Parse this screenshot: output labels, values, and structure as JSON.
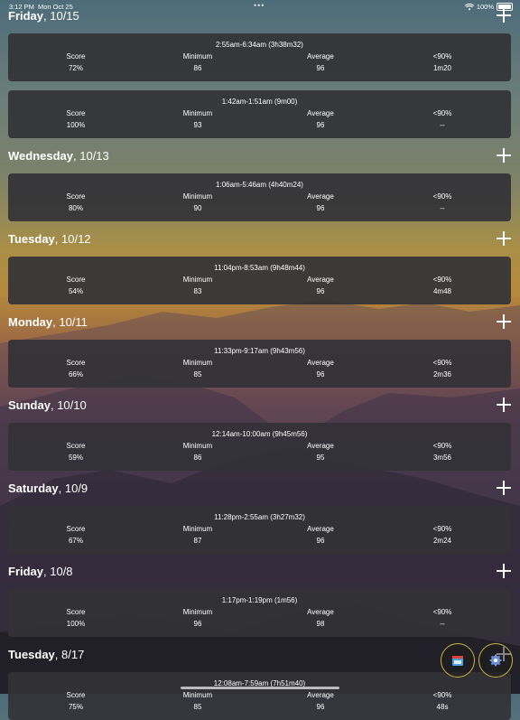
{
  "status_bar": {
    "time": "3:12 PM",
    "date": "Mon Oct 25",
    "dots": "•••",
    "battery": "100%"
  },
  "days": [
    {
      "weekday": "Friday",
      "date": ", 10/15",
      "sessions": [
        {
          "range": "2:55am-6:34am (3h38m32)",
          "score": "72%",
          "minimum": "86",
          "average": "96",
          "below90": "1m20"
        },
        {
          "range": "1:42am-1:51am (9m00)",
          "score": "100%",
          "minimum": "93",
          "average": "96",
          "below90": "--"
        }
      ]
    },
    {
      "weekday": "Wednesday",
      "date": ", 10/13",
      "sessions": [
        {
          "range": "1:06am-5:46am (4h40m24)",
          "score": "80%",
          "minimum": "90",
          "average": "96",
          "below90": "--"
        }
      ]
    },
    {
      "weekday": "Tuesday",
      "date": ", 10/12",
      "sessions": [
        {
          "range": "11:04pm-8:53am (9h48m44)",
          "score": "54%",
          "minimum": "83",
          "average": "96",
          "below90": "4m48"
        }
      ]
    },
    {
      "weekday": "Monday",
      "date": ", 10/11",
      "sessions": [
        {
          "range": "11:33pm-9:17am (9h43m56)",
          "score": "66%",
          "minimum": "85",
          "average": "96",
          "below90": "2m36"
        }
      ]
    },
    {
      "weekday": "Sunday",
      "date": ", 10/10",
      "sessions": [
        {
          "range": "12:14am-10:00am (9h45m56)",
          "score": "59%",
          "minimum": "86",
          "average": "95",
          "below90": "3m56"
        }
      ]
    },
    {
      "weekday": "Saturday",
      "date": ", 10/9",
      "sessions": [
        {
          "range": "11:28pm-2:55am (3h27m32)",
          "score": "67%",
          "minimum": "87",
          "average": "96",
          "below90": "2m24"
        }
      ]
    },
    {
      "weekday": "Friday",
      "date": ", 10/8",
      "sessions": [
        {
          "range": "1:17pm-1:19pm (1m56)",
          "score": "100%",
          "minimum": "96",
          "average": "98",
          "below90": "--"
        }
      ]
    },
    {
      "weekday": "Tuesday",
      "date": ", 8/17",
      "sessions": [
        {
          "range": "12:08am-7:59am (7h51m40)",
          "score": "75%",
          "minimum": "85",
          "average": "96",
          "below90": "48s"
        }
      ]
    }
  ],
  "labels": {
    "score": "Score",
    "minimum": "Minimum",
    "average": "Average",
    "below90": "<90%"
  },
  "fab": {
    "accent": "#c8b43c",
    "left_icon": "calendar-icon",
    "right_icon": "gear-icon"
  }
}
